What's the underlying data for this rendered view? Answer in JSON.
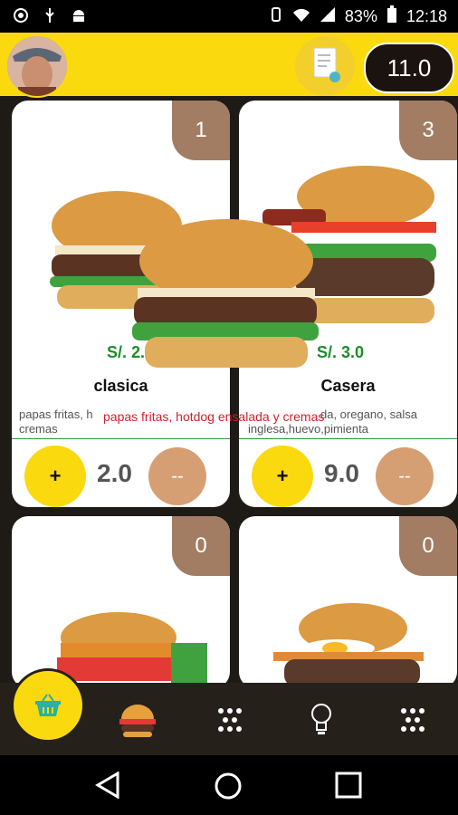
{
  "status_bar": {
    "battery": "83%",
    "time": "12:18"
  },
  "header": {
    "total": "11.0"
  },
  "cards": [
    {
      "badge": "1",
      "price": "S/. 2.0",
      "name": "clasica",
      "desc_line1": "papas fritas, h",
      "desc_line2": "cremas",
      "qty": "2.0",
      "plus": "+",
      "minus": "--"
    },
    {
      "badge": "3",
      "price": "S/. 3.0",
      "name": "Casera",
      "desc_line1": "da, oregano, salsa",
      "desc_line2": "inglesa,huevo,pimienta",
      "qty": "9.0",
      "plus": "+",
      "minus": "--"
    },
    {
      "badge": "0"
    },
    {
      "badge": "0"
    }
  ],
  "toast": "papas fritas, hotdog ensalada y cremas",
  "colors": {
    "accent": "#fbd90f",
    "badge": "#a27d63",
    "price": "#1c8c2b",
    "minus": "#d69f73",
    "nav": "#26201b"
  }
}
